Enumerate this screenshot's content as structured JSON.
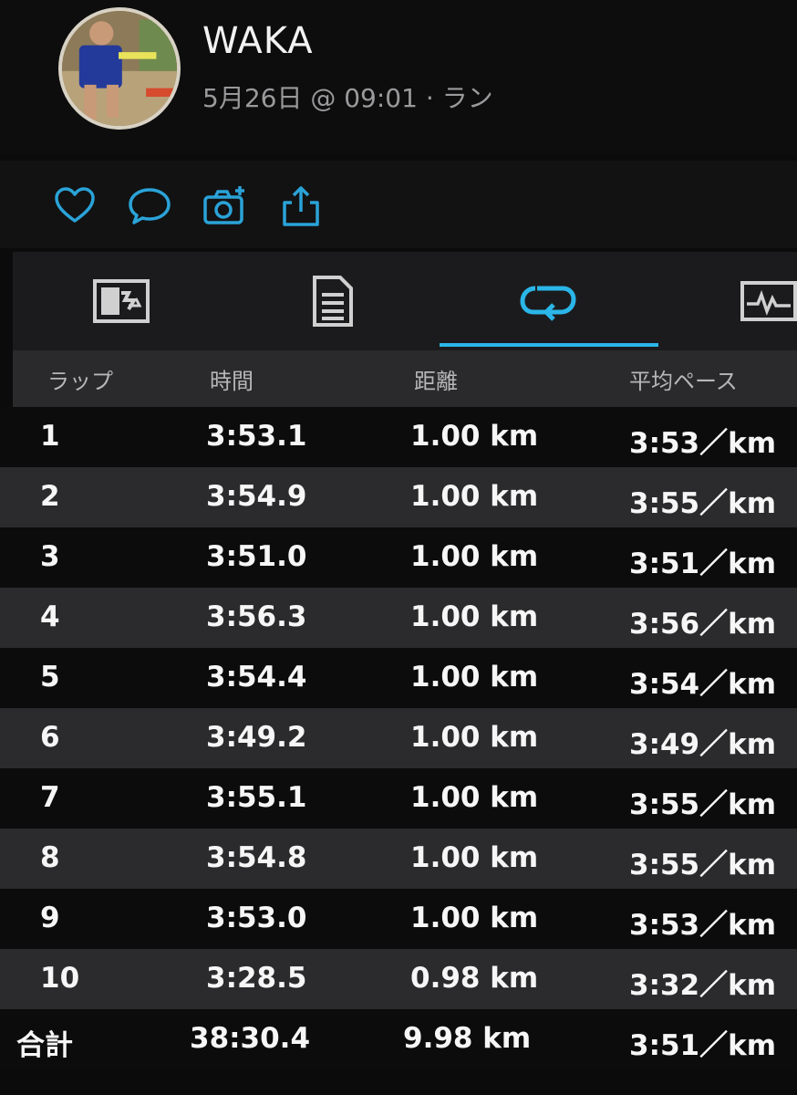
{
  "profile": {
    "name": "WAKA",
    "meta": "5月26日 @ 09:01 · ラン"
  },
  "actions": [
    {
      "icon": "heart-icon"
    },
    {
      "icon": "comment-icon"
    },
    {
      "icon": "camera-add-icon"
    },
    {
      "icon": "share-icon"
    }
  ],
  "tabs": [
    {
      "icon": "map-summary-icon",
      "selected": false
    },
    {
      "icon": "details-document-icon",
      "selected": false
    },
    {
      "icon": "laps-loop-icon",
      "selected": true
    },
    {
      "icon": "chart-icon",
      "selected": false
    }
  ],
  "colors": {
    "accent": "#2bb6e8",
    "background": "#0b0b0c",
    "row_alt": "#2b2b2d"
  },
  "table": {
    "headers": {
      "lap": "ラップ",
      "time": "時間",
      "distance": "距離",
      "pace": "平均ペース"
    },
    "rows": [
      {
        "lap": "1",
        "time": "3:53.1",
        "distance": "1.00 km",
        "pace": "3:53／km"
      },
      {
        "lap": "2",
        "time": "3:54.9",
        "distance": "1.00 km",
        "pace": "3:55／km"
      },
      {
        "lap": "3",
        "time": "3:51.0",
        "distance": "1.00 km",
        "pace": "3:51／km"
      },
      {
        "lap": "4",
        "time": "3:56.3",
        "distance": "1.00 km",
        "pace": "3:56／km"
      },
      {
        "lap": "5",
        "time": "3:54.4",
        "distance": "1.00 km",
        "pace": "3:54／km"
      },
      {
        "lap": "6",
        "time": "3:49.2",
        "distance": "1.00 km",
        "pace": "3:49／km"
      },
      {
        "lap": "7",
        "time": "3:55.1",
        "distance": "1.00 km",
        "pace": "3:55／km"
      },
      {
        "lap": "8",
        "time": "3:54.8",
        "distance": "1.00 km",
        "pace": "3:55／km"
      },
      {
        "lap": "9",
        "time": "3:53.0",
        "distance": "1.00 km",
        "pace": "3:53／km"
      },
      {
        "lap": "10",
        "time": "3:28.5",
        "distance": "0.98 km",
        "pace": "3:32／km"
      }
    ],
    "total": {
      "lap": "合計",
      "time": "38:30.4",
      "distance": "9.98 km",
      "pace": "3:51／km"
    }
  }
}
